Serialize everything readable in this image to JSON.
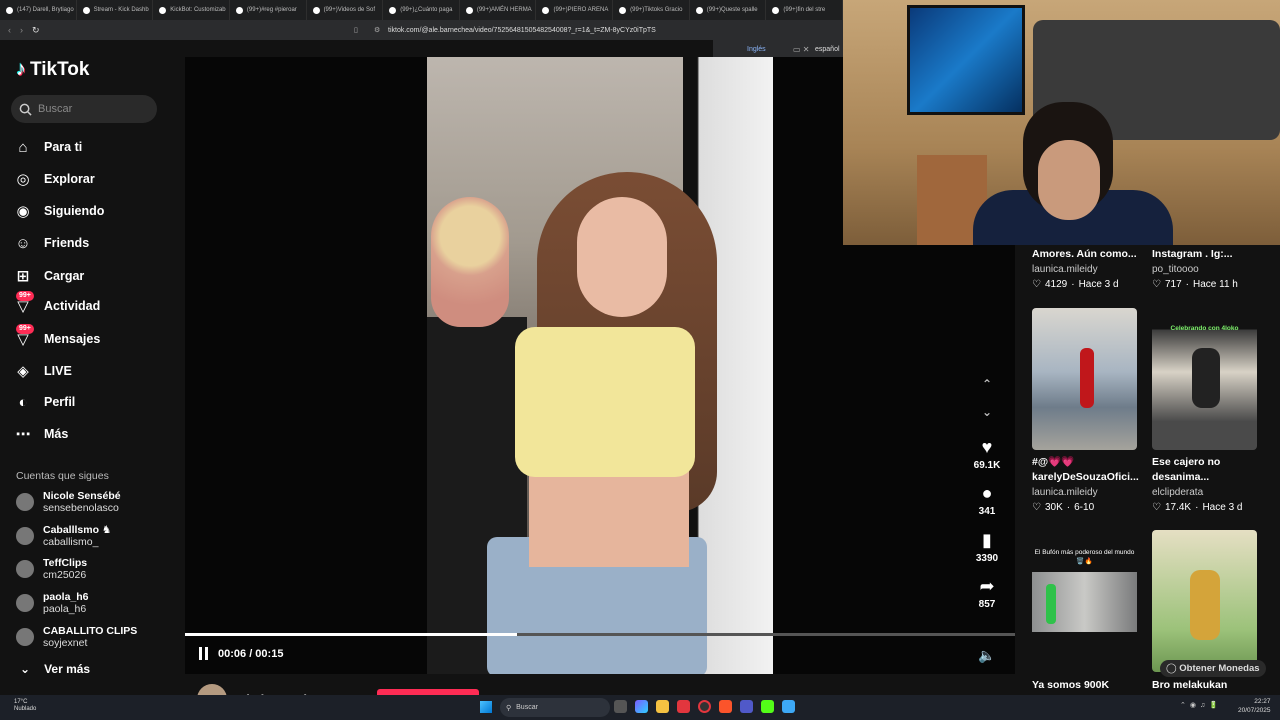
{
  "browser": {
    "tabs": [
      "(147) Darell, Brytiago",
      "Stream - Kick Dashb",
      "KickBot: Customizab",
      "(99+)#reg #pieroar",
      "(99+)Videos de Sof",
      "(99+)¿Cuánto paga",
      "(99+)AMÉN HERMA",
      "(99+)PIERO ARENA",
      "(99+)Tiktoks Gracio",
      "(99+)Queste spalle",
      "(99+)fin del stre"
    ],
    "url": "tiktok.com/@ale.barnechea/video/7525648150548254008?_r=1&_t=ZM-8yCYz0iTpTS",
    "translate": {
      "lang_a": "Inglés",
      "lang_b": "español"
    }
  },
  "sidebar": {
    "logo": "TikTok",
    "search_placeholder": "Buscar",
    "nav": [
      {
        "label": "Para ti",
        "icon": "home-icon"
      },
      {
        "label": "Explorar",
        "icon": "compass-icon"
      },
      {
        "label": "Siguiendo",
        "icon": "following-avatar-icon"
      },
      {
        "label": "Friends",
        "icon": "friends-icon"
      },
      {
        "label": "Cargar",
        "icon": "upload-icon"
      },
      {
        "label": "Actividad",
        "icon": "activity-icon",
        "badge": "99+"
      },
      {
        "label": "Mensajes",
        "icon": "messages-icon",
        "badge": "99+"
      },
      {
        "label": "LIVE",
        "icon": "live-icon"
      },
      {
        "label": "Perfil",
        "icon": "profile-icon"
      },
      {
        "label": "Más",
        "icon": "more-icon"
      }
    ],
    "following_header": "Cuentas que sigues",
    "following": [
      {
        "name": "Nicole Sensébé",
        "user": "sensebenolasco"
      },
      {
        "name": "Caballlsmo ♞",
        "user": "caballismo_"
      },
      {
        "name": "TeffClips",
        "user": "cm25026"
      },
      {
        "name": "paola_h6",
        "user": "paola_h6"
      },
      {
        "name": "CABALLITO CLIPS",
        "user": "soyjexnet"
      }
    ],
    "ver_mas": "Ver más"
  },
  "player": {
    "time": "00:06 / 00:15",
    "progress": 0.4,
    "likes": "69.1K",
    "comments": "341",
    "saves": "3390",
    "shares": "857",
    "author": "ale.barnechea"
  },
  "feed": [
    {
      "title": "Amores. Aún como...",
      "user": "launica.mileidy",
      "likes": "4129",
      "age": "Hace 3 d"
    },
    {
      "title": "Instagram . Ig:...",
      "user": "po_titoooo",
      "likes": "717",
      "age": "Hace 11 h"
    },
    {
      "title": "#@💗💗 karelyDeSouzaOfici...",
      "user": "launica.mileidy",
      "likes": "30K",
      "age": "6-10"
    },
    {
      "title": "Ese cajero no desanima...",
      "user": "elclipderata",
      "likes": "17.4K",
      "age": "Hace 3 d"
    },
    {
      "title": "Ya somos 900K",
      "user": "",
      "likes": "",
      "age": ""
    },
    {
      "title": "Bro melakukan",
      "user": "",
      "likes": "",
      "age": ""
    }
  ],
  "thumb_captions": {
    "celebrando": "Celebrando con 4loko",
    "bufon": "El Bufón más poderoso del mundo 🗑️🔥"
  },
  "monedas": "Obtener Monedas",
  "taskbar": {
    "temp": "17°C",
    "weather": "Nublado",
    "search": "Buscar",
    "time": "22:27",
    "date": "20/07/2025"
  },
  "colors": {
    "accent": "#fe2c55",
    "bg": "#121212"
  }
}
